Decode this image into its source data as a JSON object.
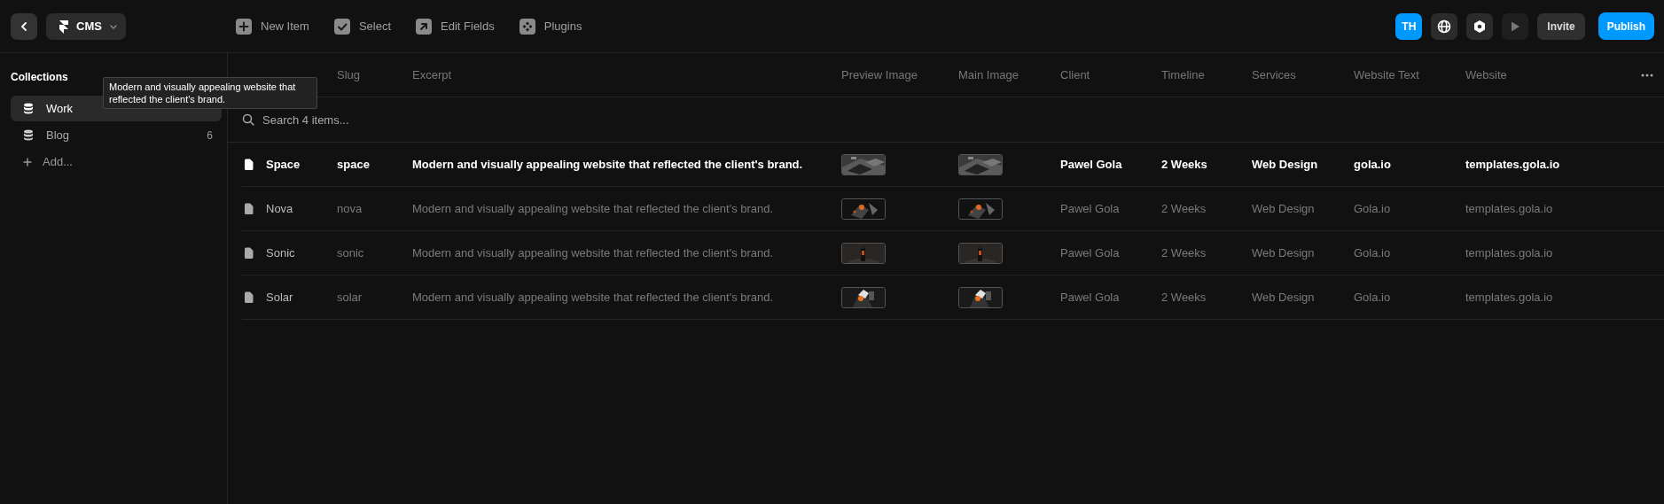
{
  "toolbar": {
    "cms_label": "CMS",
    "actions": [
      {
        "label": "New Item",
        "kind": "plus"
      },
      {
        "label": "Select",
        "kind": "check"
      },
      {
        "label": "Edit Fields",
        "kind": "arrow"
      },
      {
        "label": "Plugins",
        "kind": "plugins"
      }
    ],
    "avatar": "TH",
    "invite": "Invite",
    "publish": "Publish"
  },
  "sidebar": {
    "title": "Collections",
    "items": [
      {
        "label": "Work",
        "selected": true
      },
      {
        "label": "Blog",
        "count": "6",
        "selected": false
      }
    ],
    "add": "Add..."
  },
  "tooltip": "Modern and visually appealing website that reflected the client's brand.",
  "table": {
    "columns": [
      {
        "kind": "title"
      },
      {
        "label": "Slug",
        "kind": "text"
      },
      {
        "label": "Excerpt",
        "kind": "text"
      },
      {
        "label": "Preview Image"
      },
      {
        "label": "Main Image"
      },
      {
        "label": "Client",
        "kind": "text"
      },
      {
        "label": "Timeline",
        "kind": "text"
      },
      {
        "label": "Services",
        "kind": "text"
      },
      {
        "label": "Website Text",
        "kind": "text"
      },
      {
        "label": "Website",
        "kind": "text"
      }
    ],
    "search": {
      "placeholder": "Search 4 items..."
    },
    "rows": [
      {
        "selected": true,
        "cells": [
          "Space",
          "space",
          "Modern and visually appealing website that reflected the client's brand.",
          {
            "kind": "picture"
          },
          {
            "kind": "picture"
          },
          "Pawel Gola",
          "2 Weeks",
          "Web Design",
          "gola.io",
          "templates.gola.io"
        ]
      },
      {
        "selected": false,
        "cells": [
          "Nova",
          "nova",
          "Modern and visually appealing website that reflected the client's brand.",
          {
            "kind": "picture"
          },
          {
            "kind": "picture"
          },
          "Pawel Gola",
          "2 Weeks",
          "Web Design",
          "Gola.io",
          "templates.gola.io"
        ]
      },
      {
        "selected": false,
        "cells": [
          "Sonic",
          "sonic",
          "Modern and visually appealing website that reflected the client's brand.",
          {
            "kind": "picture"
          },
          {
            "kind": "picture"
          },
          "Pawel Gola",
          "2 Weeks",
          "Web Design",
          "Gola.io",
          "templates.gola.io"
        ]
      },
      {
        "selected": false,
        "cells": [
          "Solar",
          "solar",
          "Modern and visually appealing website that reflected the client's brand.",
          {
            "kind": "picture"
          },
          {
            "kind": "picture"
          },
          "Pawel Gola",
          "2 Weeks",
          "Web Design",
          "Gola.io",
          "templates.gola.io"
        ]
      }
    ]
  }
}
